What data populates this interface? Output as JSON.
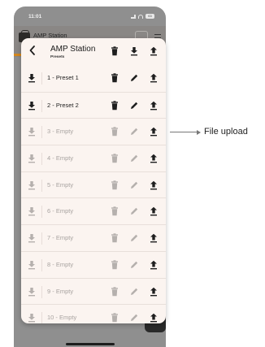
{
  "status_bar": {
    "time": "11:01",
    "battery": "63"
  },
  "background": {
    "title": "AMP Station"
  },
  "modal": {
    "title": "AMP Station",
    "subtitle": "Presets"
  },
  "presets": [
    {
      "label": "1 - Preset 1",
      "empty": false
    },
    {
      "label": "2 - Preset 2",
      "empty": false
    },
    {
      "label": "3 - Empty",
      "empty": true
    },
    {
      "label": "4 - Empty",
      "empty": true
    },
    {
      "label": "5 - Empty",
      "empty": true
    },
    {
      "label": "6 - Empty",
      "empty": true
    },
    {
      "label": "7 - Empty",
      "empty": true
    },
    {
      "label": "8 - Empty",
      "empty": true
    },
    {
      "label": "9 - Empty",
      "empty": true
    },
    {
      "label": "10 - Empty",
      "empty": true
    }
  ],
  "icons": {
    "back": "chevron-left-icon",
    "delete": "trash-icon",
    "download": "download-icon",
    "upload": "upload-icon",
    "edit": "pencil-icon"
  },
  "colors": {
    "active_icon": "#1e1e1e",
    "disabled_icon": "#b5b0ad",
    "modal_bg": "#fbf4f0",
    "accent": "#d4881f"
  },
  "annotation": {
    "text": "File upload"
  }
}
